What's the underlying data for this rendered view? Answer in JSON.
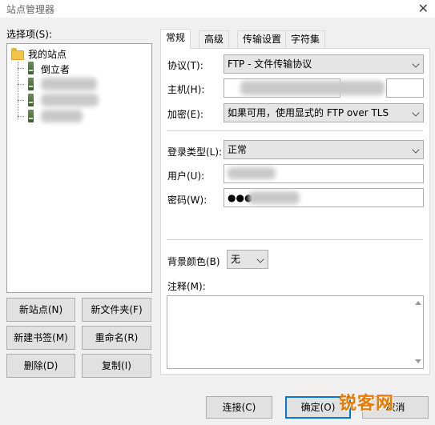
{
  "window": {
    "title": "站点管理器"
  },
  "left": {
    "select_label": "选择项(S):",
    "tree": [
      {
        "label": "我的站点"
      },
      {
        "label": "倒立者"
      },
      {
        "label": ""
      },
      {
        "label": ""
      },
      {
        "label": ""
      }
    ],
    "buttons": {
      "new_site": "新站点(N)",
      "new_folder": "新文件夹(F)",
      "new_bookmark": "新建书签(M)",
      "rename": "重命名(R)",
      "delete": "删除(D)",
      "copy": "复制(I)"
    }
  },
  "tabs": [
    {
      "label": "常规",
      "active": true
    },
    {
      "label": "高级",
      "active": false
    },
    {
      "label": "传输设置",
      "active": false
    },
    {
      "label": "字符集",
      "active": false
    }
  ],
  "form": {
    "protocol_label": "协议(T):",
    "protocol_value": "FTP - 文件传输协议",
    "host_label": "主机(H):",
    "host_value": "",
    "port_value": "",
    "encryption_label": "加密(E):",
    "encryption_value": "如果可用，使用显式的 FTP over TLS",
    "logon_label": "登录类型(L):",
    "logon_value": "正常",
    "user_label": "用户(U):",
    "user_value": "",
    "password_label": "密码(W):",
    "password_value": "●●●",
    "bgcolor_label": "背景颜色(B)",
    "bgcolor_value": "无",
    "comment_label": "注释(M):"
  },
  "footer": {
    "connect": "连接(C)",
    "ok": "确定(O)",
    "cancel": "取消"
  },
  "watermark": {
    "logo": "锐客网"
  }
}
